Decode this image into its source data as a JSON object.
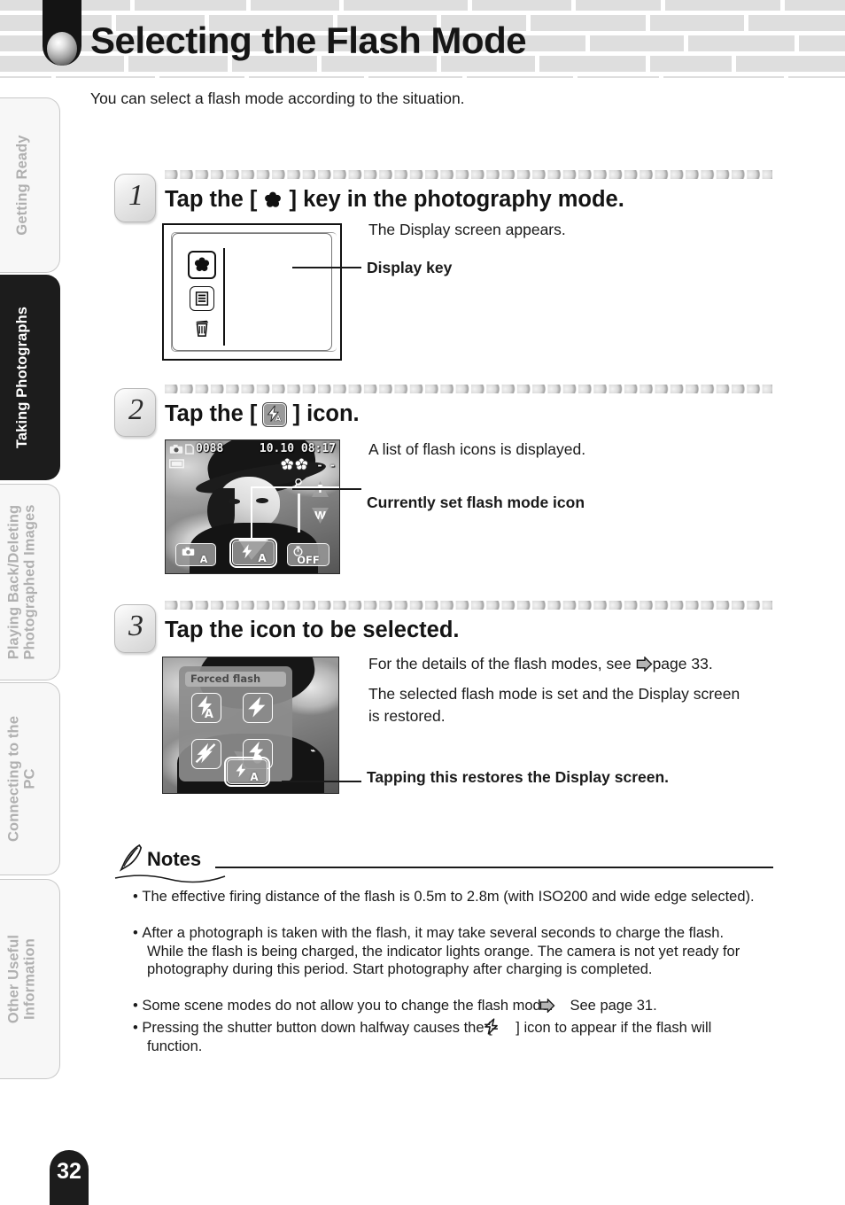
{
  "header": {
    "title": "Selecting the Flash Mode",
    "orb_icon": "sphere-bullet-icon"
  },
  "sidebar": {
    "tabs": [
      {
        "label": "Getting Ready",
        "active": false
      },
      {
        "label": "Taking Photographs",
        "active": true
      },
      {
        "label": "Playing Back/Deleting\nPhotographed Images",
        "active": false
      },
      {
        "label": "Connecting to the\nPC",
        "active": false
      },
      {
        "label": "Other Useful\nInformation",
        "active": false
      }
    ]
  },
  "page_number": "32",
  "intro": "You can select a flash mode according to the situation.",
  "steps": [
    {
      "number": "1",
      "heading_before": "Tap the [",
      "heading_icon": "display-key-flower-icon",
      "heading_after": "] key in the photography mode.",
      "body": "The Display screen appears.",
      "callout": "Display key",
      "device": {
        "type": "display-screen-keys",
        "keys": [
          "flower-display-key-icon",
          "list-menu-icon",
          "trash-icon"
        ]
      }
    },
    {
      "number": "2",
      "heading_before": "Tap the [",
      "heading_icon": "flash-auto-icon",
      "heading_after": "] icon.",
      "body": "A list of flash icons is displayed.",
      "callout": "Currently set flash mode icon",
      "lcd": {
        "frame_counter": "0088",
        "datetime": "10.10 08:17",
        "mode_icon": "camera-icon",
        "battery_icon": "battery-icon",
        "card_icon": "memory-card-icon",
        "flower_icons": "macro-flower-icons",
        "dash_marks": "- -",
        "zoom_tele": "T",
        "zoom_wide": "W",
        "buttons": [
          {
            "icon": "scene-mode-auto-icon",
            "label": "A"
          },
          {
            "icon": "flash-auto-icon",
            "label": "A",
            "selected": true
          },
          {
            "icon": "self-timer-icon",
            "label": "OFF"
          }
        ]
      }
    },
    {
      "number": "3",
      "heading_before": "Tap the icon to be selected.",
      "heading_icon": "",
      "heading_after": "",
      "body_1_before": "For the details of the flash modes, see",
      "body_1_icon": "arrow-pointer-icon",
      "body_1_after": "page 33.",
      "body_2": "The selected flash mode is set and the Display screen is restored.",
      "callout": "Tapping this restores the Display screen.",
      "lcd": {
        "popup_title": "Forced flash",
        "modes": [
          "flash-auto-icon",
          "flash-forced-icon",
          "flash-off-icon",
          "flash-redeye-icon"
        ],
        "current_button": {
          "icon": "flash-auto-icon",
          "label": "A"
        }
      }
    }
  ],
  "notes": {
    "title": "Notes",
    "icon": "pen-feather-icon",
    "items": [
      "The effective firing distance of the flash is 0.5m to 2.8m (with ISO200 and wide edge selected).",
      "After a photograph is taken with the flash, it may take several seconds to charge the flash. While the flash is being charged, the indicator lights orange. The camera is not yet ready for photography during this period. Start photography after charging is completed.",
      "Some scene modes do not allow you to change the flash mode.",
      "Pressing the shutter button down halfway causes the ["
    ],
    "item3_after_icon": "See page 31.",
    "item3_icon": "arrow-pointer-icon",
    "item4_icon": "flash-lightning-icon",
    "item4_after_icon": "] icon to appear if the flash will function."
  },
  "colors": {
    "brick": "#dedede",
    "active_tab": "#1c1c1c",
    "inactive_tab_text": "#b0b0b0",
    "text": "#1a1a1a"
  }
}
